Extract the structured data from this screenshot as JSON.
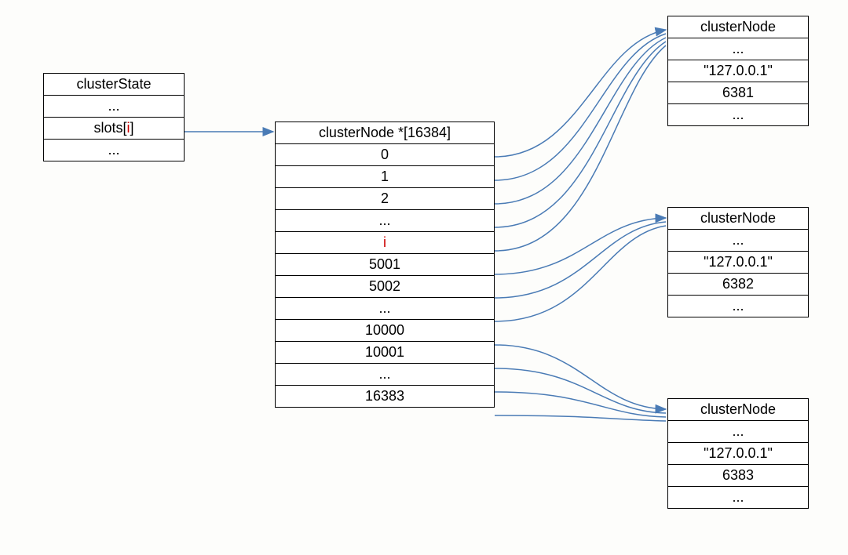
{
  "clusterState": {
    "title": "clusterState",
    "row1": "...",
    "slots_prefix": "slots[",
    "slots_i": "i",
    "slots_suffix": "]",
    "row3": "..."
  },
  "slotArray": {
    "title": "clusterNode *[16384]",
    "rows": [
      "0",
      "1",
      "2",
      "...",
      "i",
      "5001",
      "5002",
      "...",
      "10000",
      "10001",
      "...",
      "16383"
    ]
  },
  "nodes": [
    {
      "title": "clusterNode",
      "row1": "...",
      "ip": "\"127.0.0.1\"",
      "port": "6381",
      "row4": "..."
    },
    {
      "title": "clusterNode",
      "row1": "...",
      "ip": "\"127.0.0.1\"",
      "port": "6382",
      "row4": "..."
    },
    {
      "title": "clusterNode",
      "row1": "...",
      "ip": "\"127.0.0.1\"",
      "port": "6383",
      "row4": "..."
    }
  ]
}
